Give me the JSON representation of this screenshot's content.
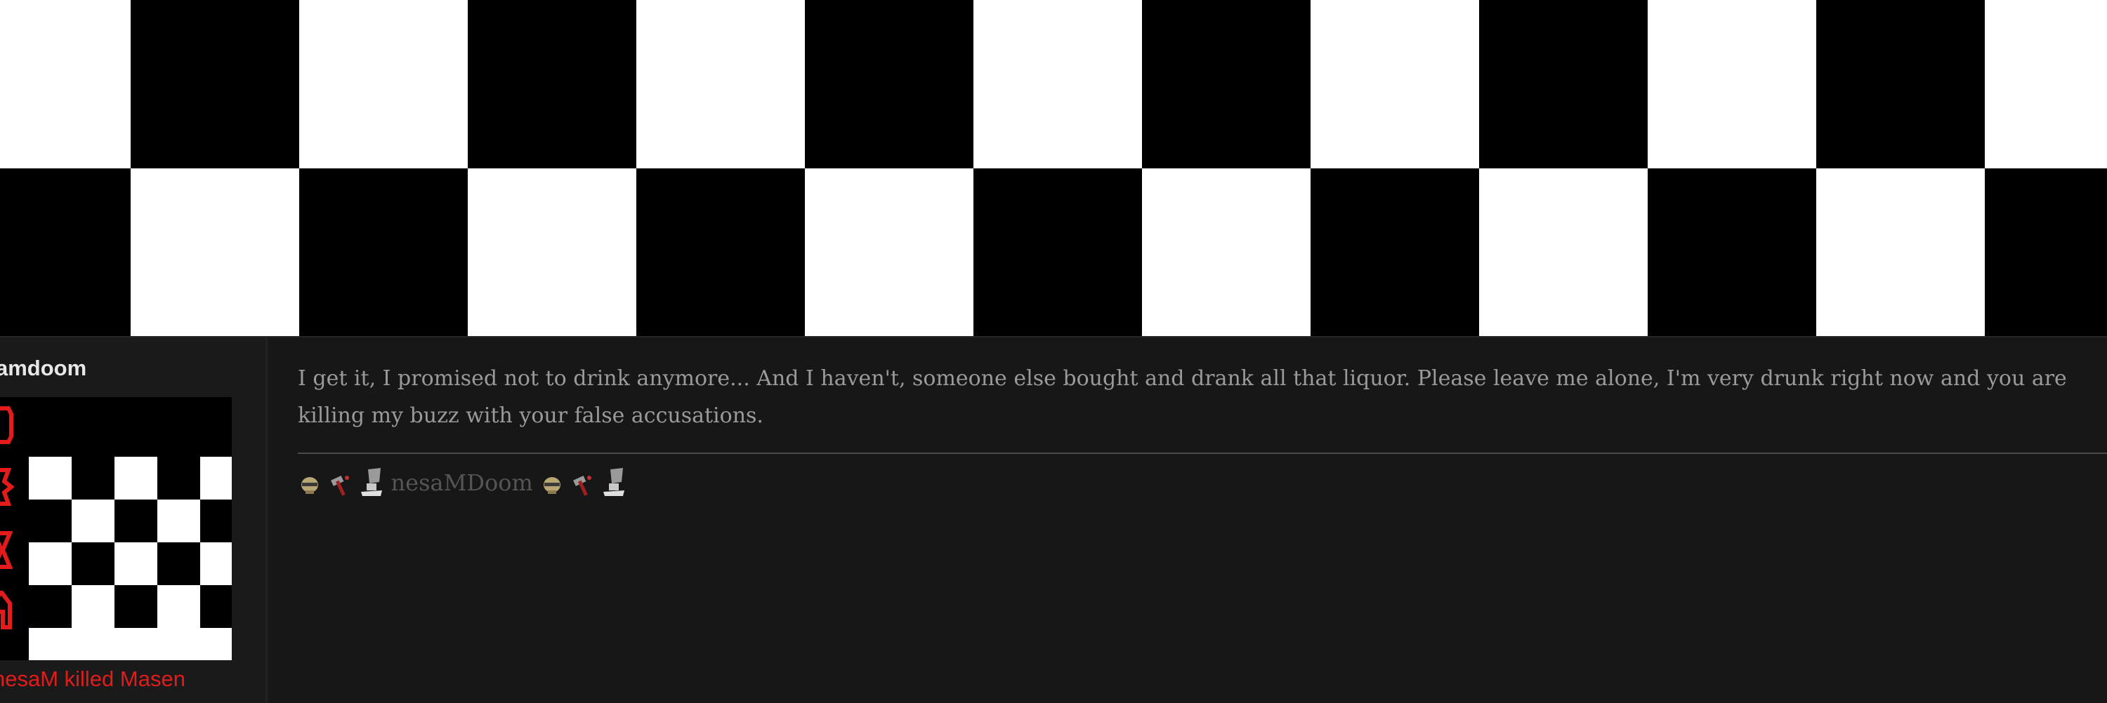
{
  "post": {
    "author": {
      "username": "amdoom",
      "title": "nesaM killed Masen"
    },
    "body": "I get it, I promised not to drink anymore... And I haven't, someone else bought and drank all that liquor. Please leave me alone, I'm very drunk right now and you are killing my buzz with your false accusations.",
    "signature": {
      "text": "nesaMDoom",
      "icons": [
        "skull-icon",
        "hammer-icon",
        "anvil-icon"
      ]
    }
  },
  "colors": {
    "page_background": "#171717",
    "body_text": "#9a9a9a",
    "username": "#e8e8e8",
    "user_title": "#e31b1b",
    "signature_text": "#555555"
  }
}
